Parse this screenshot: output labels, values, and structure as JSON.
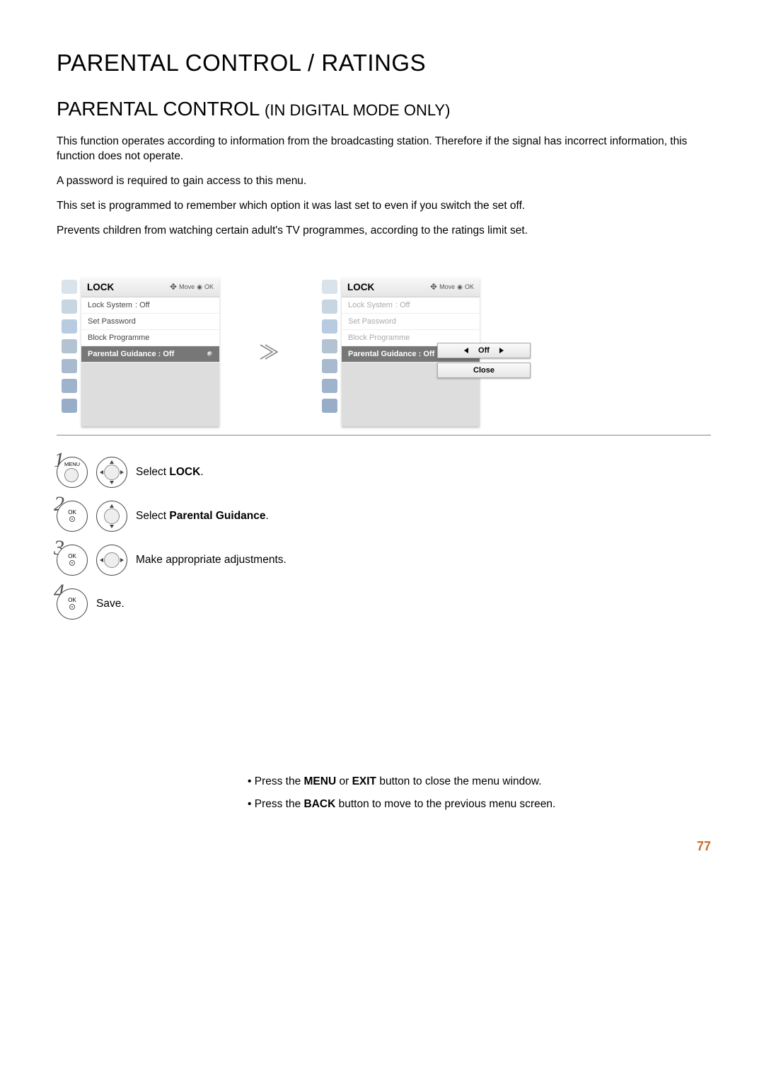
{
  "page_title": "PARENTAL CONTROL / RATINGS",
  "section_title_main": "PARENTAL CONTROL ",
  "section_title_sub": "(IN DIGITAL MODE ONLY)",
  "intro_p1": "This function operates according to information from the broadcasting station. Therefore if the signal has incorrect information, this function does not operate.",
  "intro_p2": "A password is required to gain access to this menu.",
  "intro_p3": "This set is programmed to remember which option it was last set to even if you switch the set off.",
  "intro_p4": "Prevents children from watching certain adult's TV programmes, according to the ratings limit set.",
  "menu": {
    "title": "LOCK",
    "hint_move": "Move",
    "hint_ok": "OK",
    "items": {
      "lock_system_label": "Lock System",
      "lock_system_value": ": Off",
      "set_password": "Set Password",
      "block_programme": "Block Programme",
      "parental_guidance_label": "Parental Guidance",
      "parental_guidance_value": ": Off"
    }
  },
  "popup": {
    "value": "Off",
    "close": "Close"
  },
  "steps": {
    "s1_btn": "MENU",
    "s1_pre": "Select ",
    "s1_bold": "LOCK",
    "s1_post": ".",
    "s2_btn": "OK",
    "s2_pre": "Select ",
    "s2_bold": "Parental Guidance",
    "s2_post": ".",
    "s3_btn": "OK",
    "s3_text": "Make appropriate adjustments.",
    "s4_btn": "OK",
    "s4_text": "Save."
  },
  "notes": {
    "n1_pre": "• Press the ",
    "n1_b1": "MENU",
    "n1_mid": " or ",
    "n1_b2": "EXIT",
    "n1_post": " button to close the menu window.",
    "n2_pre": "• Press the ",
    "n2_b1": "BACK",
    "n2_post": " button to move to the previous menu screen."
  },
  "page_number": "77"
}
